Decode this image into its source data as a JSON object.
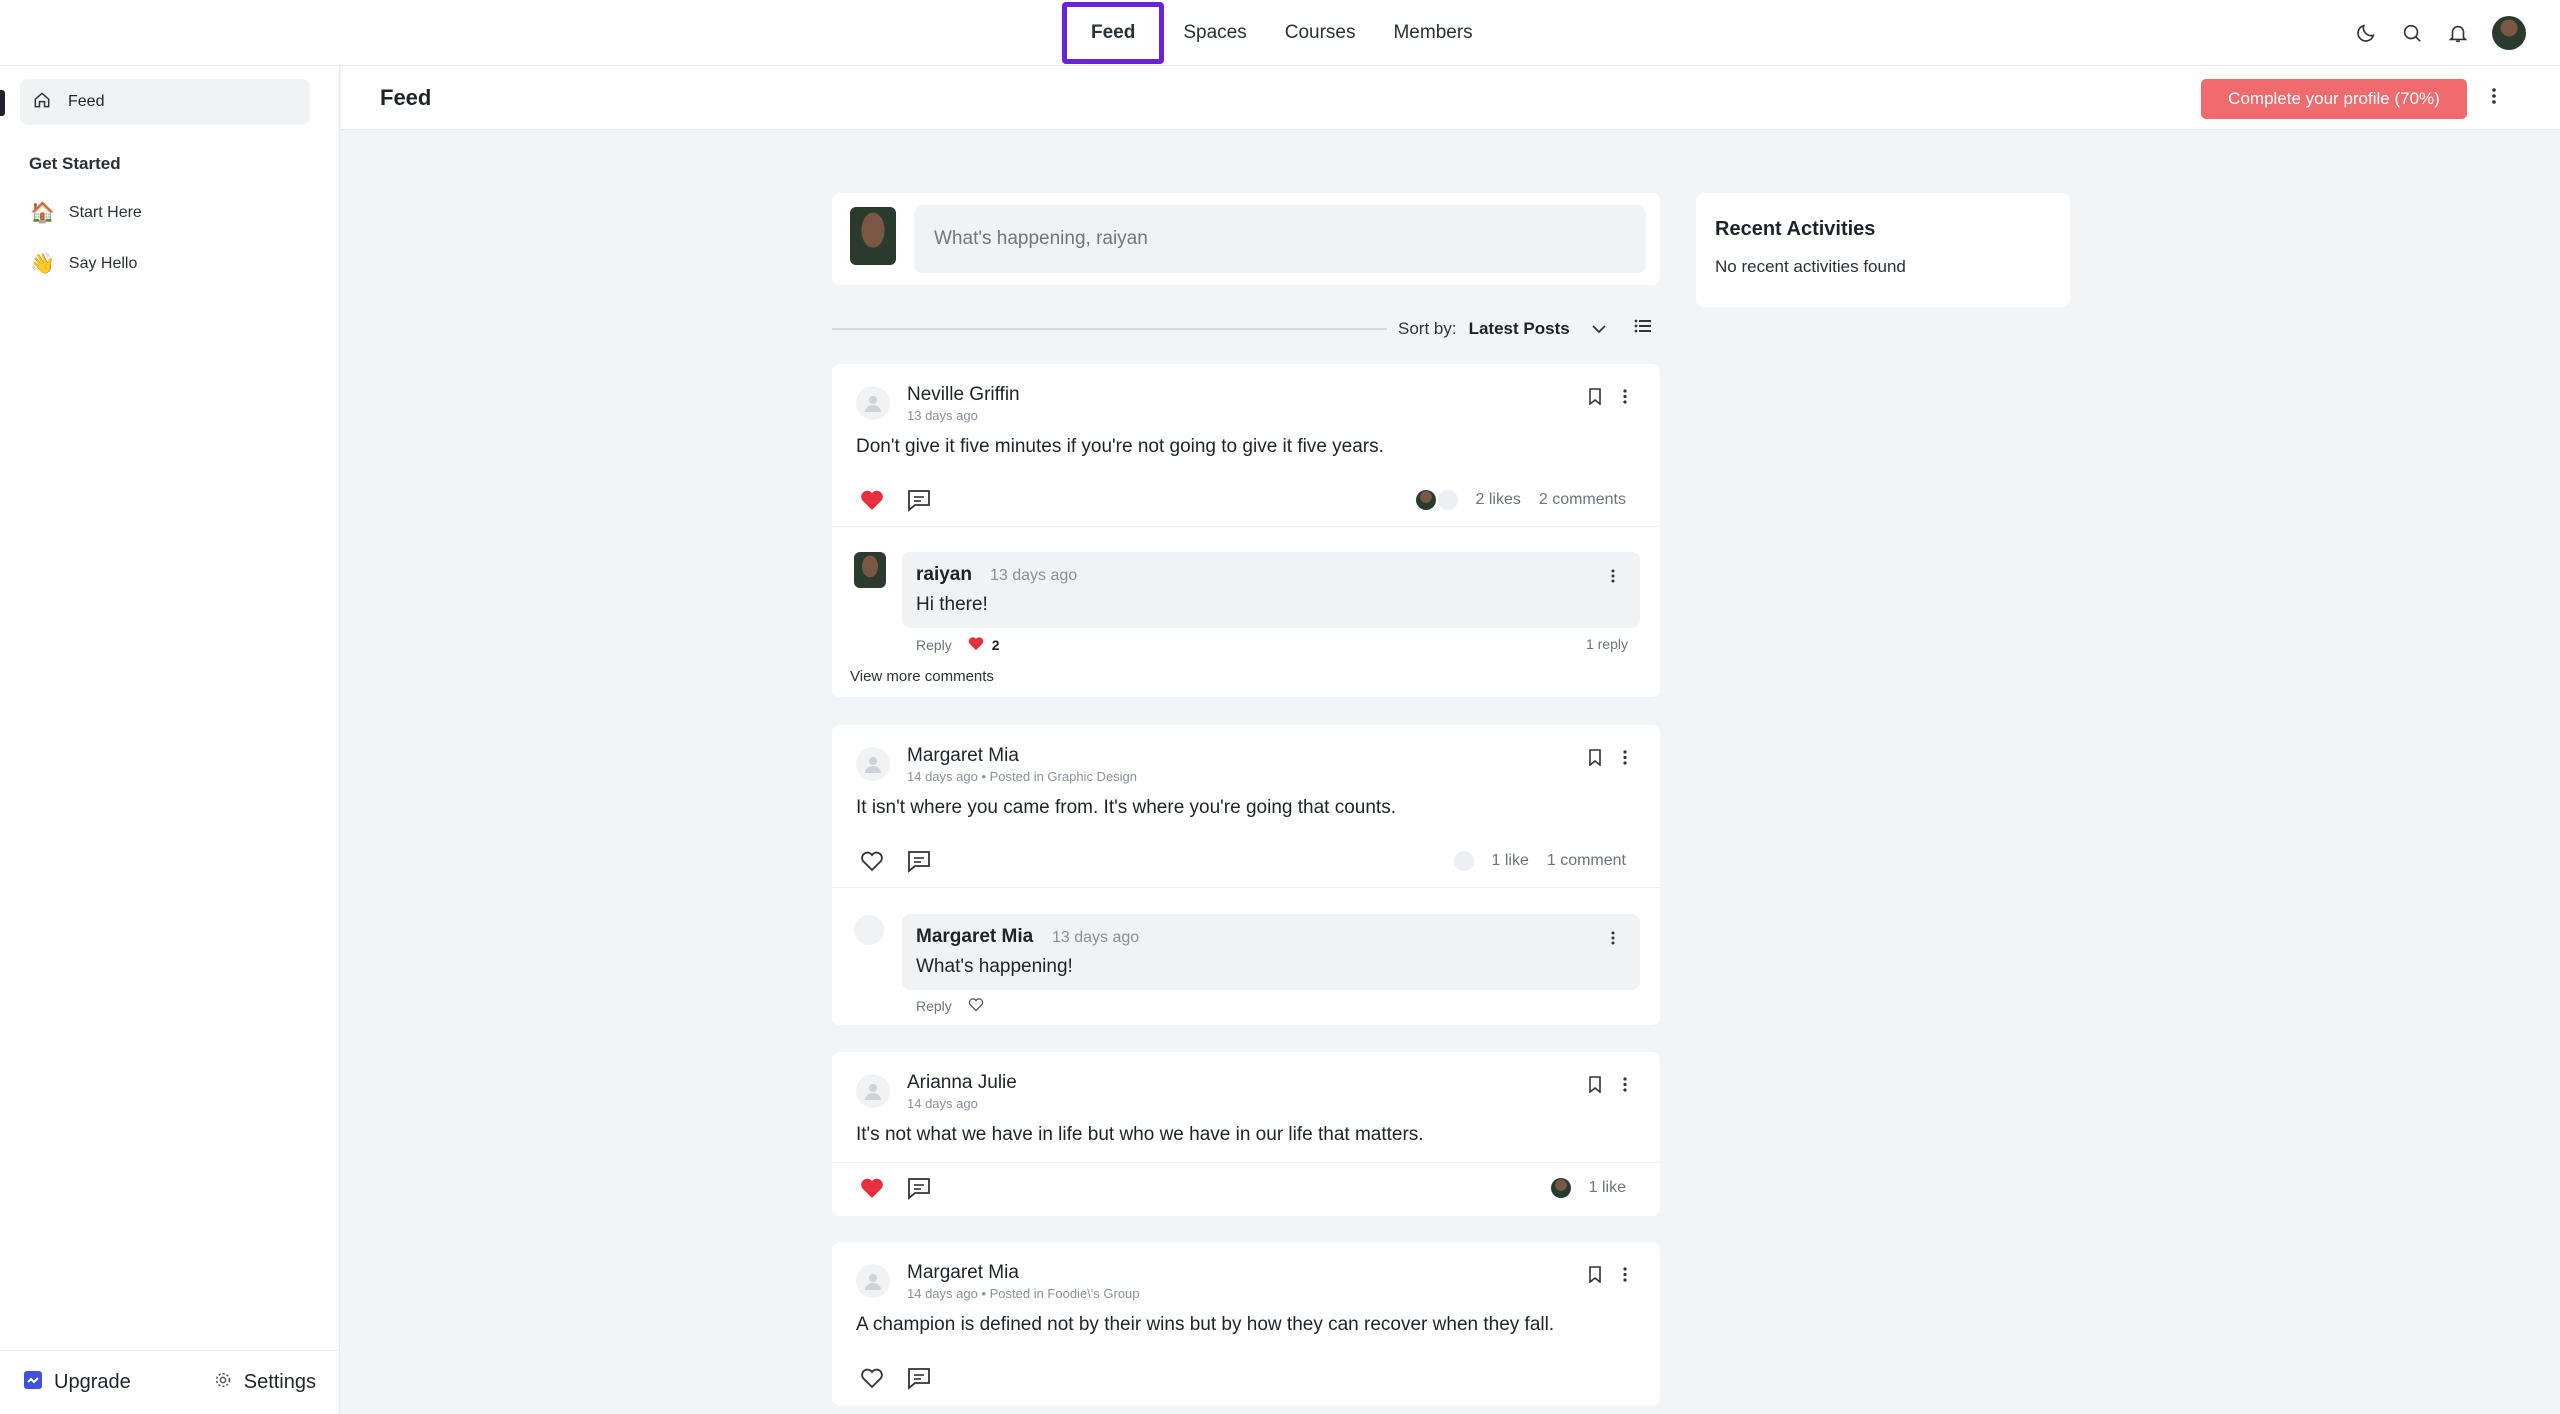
{
  "topnav": {
    "tabs": [
      {
        "label": "Feed",
        "active": true
      },
      {
        "label": "Spaces"
      },
      {
        "label": "Courses"
      },
      {
        "label": "Members"
      }
    ],
    "icons": [
      "moon-icon",
      "search-icon",
      "bell-icon",
      "user-avatar"
    ]
  },
  "sidebar": {
    "feed_label": "Feed",
    "section_title": "Get Started",
    "items": [
      {
        "emoji": "🏠",
        "label": "Start Here"
      },
      {
        "emoji": "👋",
        "label": "Say Hello"
      }
    ],
    "upgrade_label": "Upgrade",
    "settings_label": "Settings"
  },
  "header": {
    "title": "Feed",
    "profile_button": "Complete your profile (70%)"
  },
  "composer": {
    "placeholder": "What's happening, raiyan"
  },
  "sort": {
    "label": "Sort by:",
    "value": "Latest Posts"
  },
  "posts": [
    {
      "author": "Neville Griffin",
      "meta": "13 days ago",
      "body": "Don't give it five minutes if you're not going to give it five years.",
      "liked": true,
      "likes": "2 likes",
      "comments": "2 comments",
      "comment": {
        "author": "raiyan",
        "time": "13 days ago",
        "text": "Hi there!",
        "reply": "Reply",
        "likes": "2",
        "replies": "1 reply"
      },
      "view_more": "View more comments"
    },
    {
      "author": "Margaret Mia",
      "meta": "14 days ago • Posted in Graphic Design",
      "body": "It isn't where you came from. It's where you're going that counts.",
      "liked": false,
      "likes": "1 like",
      "comments": "1 comment",
      "comment": {
        "author": "Margaret Mia",
        "time": "13 days ago",
        "text": "What's happening!",
        "reply": "Reply"
      }
    },
    {
      "author": "Arianna Julie",
      "meta": "14 days ago",
      "body": "It's not what we have in life but who we have in our life that matters.",
      "liked": true,
      "likes": "1 like"
    },
    {
      "author": "Margaret Mia",
      "meta": "14 days ago • Posted in Foodie\\'s Group",
      "body": "A champion is defined not by their wins but by how they can recover when they fall.",
      "liked": false
    }
  ],
  "recent": {
    "title": "Recent Activities",
    "empty": "No recent activities found"
  },
  "colors": {
    "accent": "#6a24d6",
    "profile_button": "#ef6b6e",
    "heart": "#e5303b"
  }
}
